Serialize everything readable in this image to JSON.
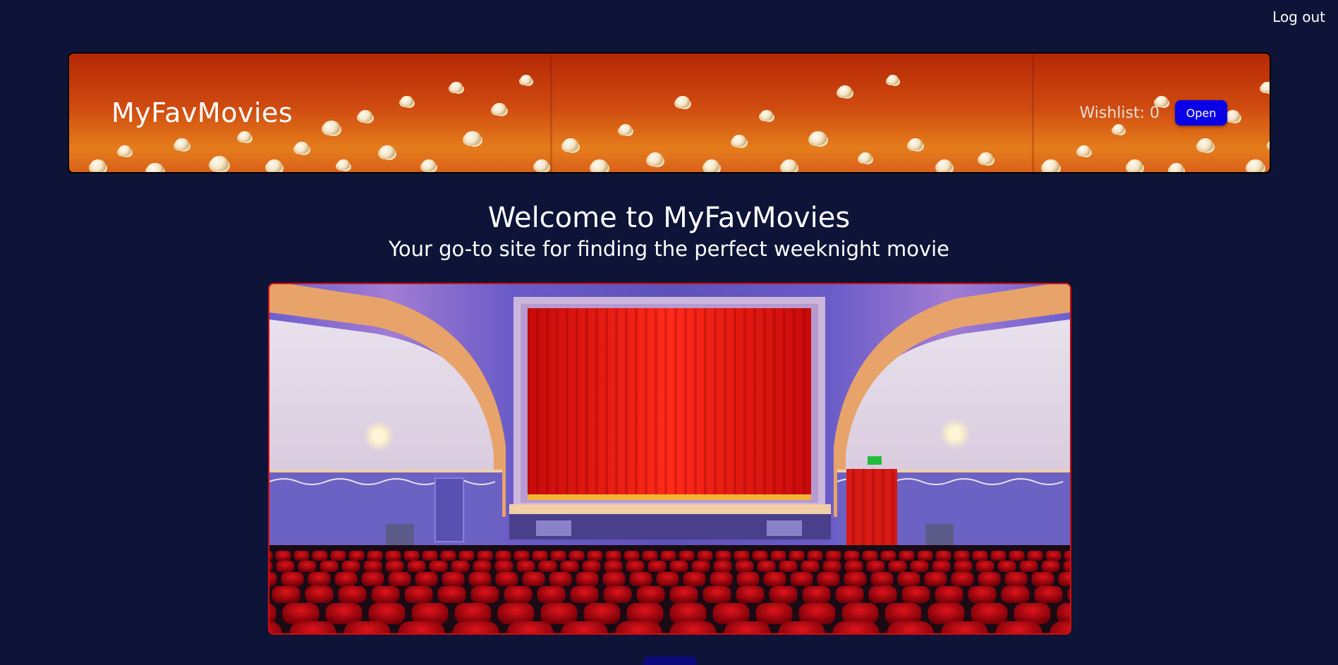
{
  "nav": {
    "logout_label": "Log out"
  },
  "header": {
    "site_title": "MyFavMovies",
    "wishlist_text": "Wishlist: 0",
    "open_button_label": "Open"
  },
  "welcome": {
    "title": "Welcome to MyFavMovies",
    "subtitle": "Your go-to site for finding the perfect weeknight movie"
  },
  "colors": {
    "page_background": "#0e1438",
    "open_button": "#0a00e8",
    "hero_border": "#d10d0d",
    "banner_orange": "#cf4a10"
  },
  "icons": {
    "banner_decoration": "popcorn",
    "hero_image": "movie-theater-red-curtain"
  }
}
